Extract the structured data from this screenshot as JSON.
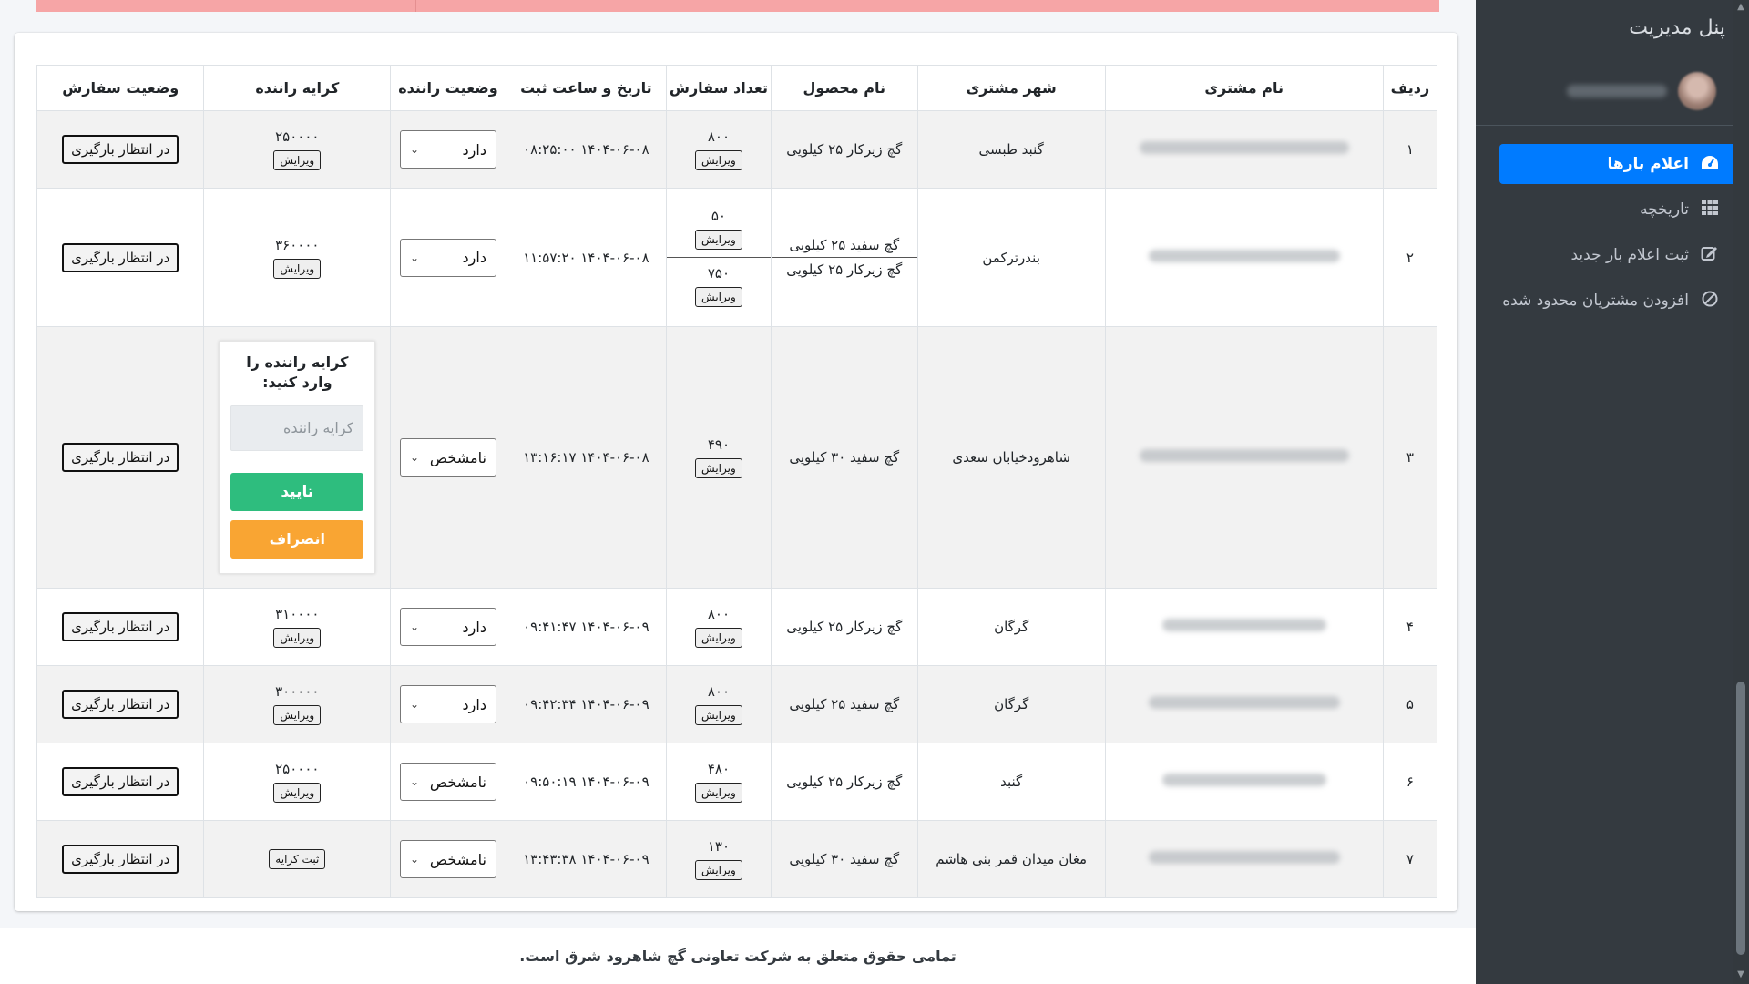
{
  "sidebar": {
    "brand": "پنل مدیریت",
    "items": [
      {
        "label": "اعلام بارها",
        "icon": "dashboard-icon",
        "active": true
      },
      {
        "label": "تاریخچه",
        "icon": "grid-icon",
        "active": false
      },
      {
        "label": "ثبت اعلام بار جدید",
        "icon": "edit-icon",
        "active": false
      },
      {
        "label": "افزودن مشتریان محدود شده",
        "icon": "ban-icon",
        "active": false
      }
    ]
  },
  "table": {
    "headers": [
      "ردیف",
      "نام مشتری",
      "شهر مشتری",
      "نام محصول",
      "تعداد سفارش",
      "تاریخ و ساعت ثبت",
      "وضعیت راننده",
      "کرایه راننده",
      "وضعیت سفارش"
    ],
    "edit_label": "ویرایش",
    "status_label": "در انتظار بارگیری",
    "rows": [
      {
        "index": "۱",
        "city": "گنبد طبسی",
        "products": [
          "گچ زیرکار ۲۵ کیلویی"
        ],
        "quantities": [
          "۸۰۰"
        ],
        "datetime": "۱۴۰۴-۰۶-۰۸ ۰۸:۲۵:۰۰",
        "driver_status": "دارد",
        "fare": "۲۵۰۰۰۰"
      },
      {
        "index": "۲",
        "city": "بندرترکمن",
        "products": [
          "گچ سفید ۲۵ کیلویی",
          "گچ زیرکار ۲۵ کیلویی"
        ],
        "quantities": [
          "۵۰",
          "۷۵۰"
        ],
        "datetime": "۱۴۰۴-۰۶-۰۸ ۱۱:۵۷:۲۰",
        "driver_status": "دارد",
        "fare": "۳۶۰۰۰۰"
      },
      {
        "index": "۳",
        "city": "شاهرودخیابان سعدی",
        "products": [
          "گچ سفید ۳۰ کیلویی"
        ],
        "quantities": [
          "۴۹۰"
        ],
        "datetime": "۱۴۰۴-۰۶-۰۸ ۱۳:۱۶:۱۷",
        "driver_status": "نامشخص",
        "fare": ""
      },
      {
        "index": "۴",
        "city": "گرگان",
        "products": [
          "گچ زیرکار ۲۵ کیلویی"
        ],
        "quantities": [
          "۸۰۰"
        ],
        "datetime": "۱۴۰۴-۰۶-۰۹ ۰۹:۴۱:۴۷",
        "driver_status": "دارد",
        "fare": "۳۱۰۰۰۰"
      },
      {
        "index": "۵",
        "city": "گرگان",
        "products": [
          "گچ سفید ۲۵ کیلویی"
        ],
        "quantities": [
          "۸۰۰"
        ],
        "datetime": "۱۴۰۴-۰۶-۰۹ ۰۹:۴۲:۳۴",
        "driver_status": "دارد",
        "fare": "۳۰۰۰۰۰"
      },
      {
        "index": "۶",
        "city": "گنبد",
        "products": [
          "گچ زیرکار ۲۵ کیلویی"
        ],
        "quantities": [
          "۴۸۰"
        ],
        "datetime": "۱۴۰۴-۰۶-۰۹ ۰۹:۵۰:۱۹",
        "driver_status": "نامشخص",
        "fare": "۲۵۰۰۰۰"
      },
      {
        "index": "۷",
        "city": "مغان میدان قمر بنی هاشم",
        "products": [
          "گچ سفید ۳۰ کیلویی"
        ],
        "quantities": [
          "۱۳۰"
        ],
        "datetime": "۱۴۰۴-۰۶-۰۹ ۱۳:۴۳:۳۸",
        "driver_status": "نامشخص",
        "fare": ""
      }
    ],
    "fare_form": {
      "label": "کرایه راننده را وارد کنید:",
      "placeholder": "کرایه راننده",
      "confirm": "تایید",
      "cancel": "انصراف"
    },
    "register_fare_label": "ثبت کرایه"
  },
  "footer": "تمامی حقوق متعلق به شرکت تعاونی گچ شاهرود شرق است.",
  "colors": {
    "active": "#007bff",
    "sidebar": "#343a40",
    "confirm": "#2ebd7e",
    "cancel": "#f9a533",
    "alert": "#f6a5a6"
  }
}
